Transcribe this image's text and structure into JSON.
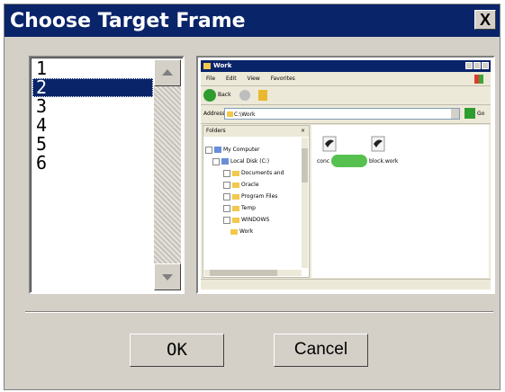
{
  "dialog": {
    "title": "Choose Target Frame",
    "close_label": "X"
  },
  "frame_list": {
    "items": [
      "1",
      "2",
      "3",
      "4",
      "5",
      "6"
    ],
    "selected_index": 1
  },
  "preview": {
    "window_title": "Work",
    "menu": [
      "File",
      "Edit",
      "View",
      "Favorites"
    ],
    "back_label": "Back",
    "address_label": "Address",
    "address_value": "C:\\Work",
    "go_label": "Go",
    "folders_label": "Folders",
    "folders_close": "×",
    "tree": [
      {
        "label": "My Computer",
        "icon": "computer-icon"
      },
      {
        "label": "Local Disk (C:)",
        "icon": "drive-icon"
      },
      {
        "label": "Documents and",
        "icon": "folder-icon"
      },
      {
        "label": "Oracle",
        "icon": "folder-icon"
      },
      {
        "label": "Program Files",
        "icon": "folder-icon"
      },
      {
        "label": "Temp",
        "icon": "folder-icon"
      },
      {
        "label": "WINDOWS",
        "icon": "folder-icon"
      },
      {
        "label": "Work",
        "icon": "folder-open-icon"
      }
    ],
    "files": [
      "conc",
      "block.work"
    ]
  },
  "buttons": {
    "ok": "OK",
    "cancel": "Cancel"
  },
  "colors": {
    "titlebar": "#0a246a",
    "selection": "#0a246a",
    "face": "#d4d0c8"
  }
}
